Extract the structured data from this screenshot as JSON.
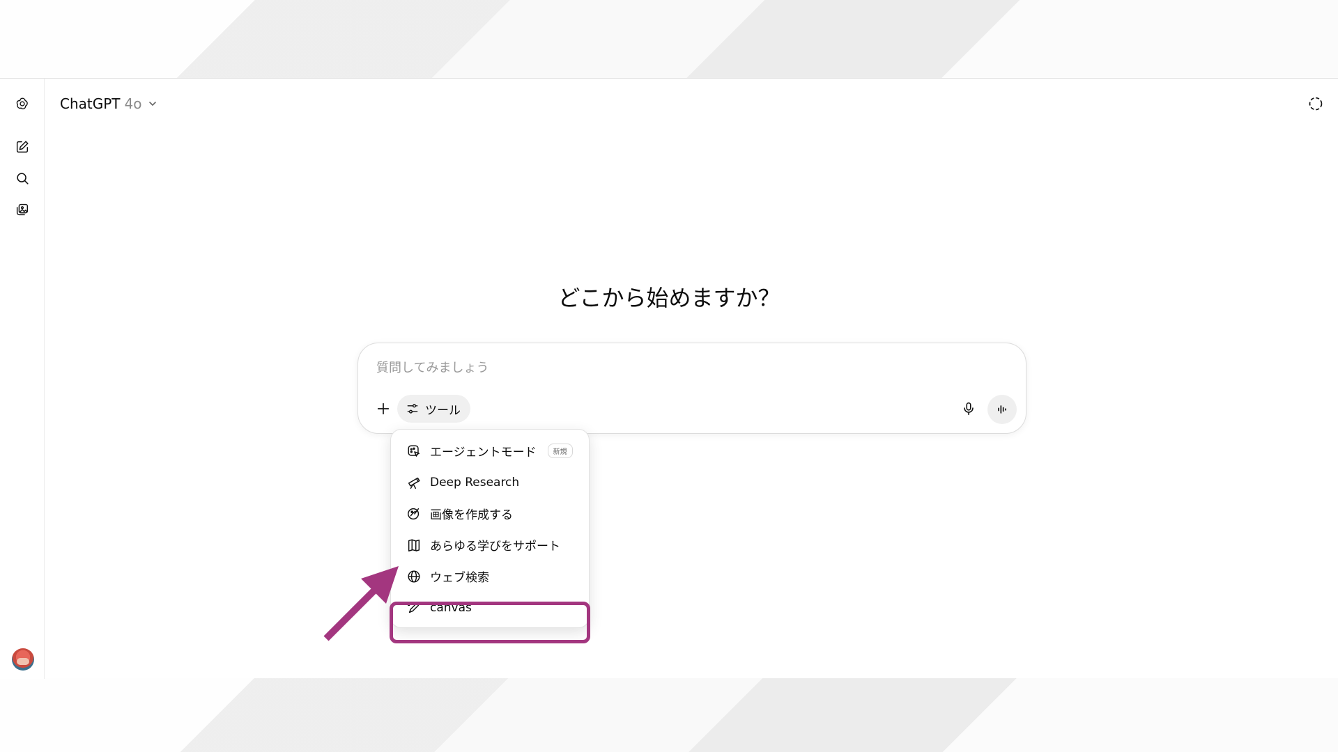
{
  "header": {
    "model_name": "ChatGPT",
    "model_version": "4o"
  },
  "main": {
    "headline": "どこから始めますか？"
  },
  "composer": {
    "placeholder": "質問してみましょう",
    "tools_label": "ツール"
  },
  "tools_menu": {
    "items": [
      {
        "label": "エージェントモード",
        "badge": "新規",
        "icon": "agent-icon"
      },
      {
        "label": "Deep Research",
        "icon": "telescope-icon"
      },
      {
        "label": "画像を作成する",
        "icon": "image-create-icon"
      },
      {
        "label": "あらゆる学びをサポート",
        "icon": "book-icon"
      },
      {
        "label": "ウェブ検索",
        "icon": "globe-icon"
      },
      {
        "label": "canvas",
        "icon": "pen-icon"
      }
    ]
  },
  "sidebar": {
    "icons": [
      "openai-logo-icon",
      "new-chat-icon",
      "search-icon",
      "library-icon"
    ]
  },
  "annotation": {
    "highlight_color": "#a3367f"
  }
}
